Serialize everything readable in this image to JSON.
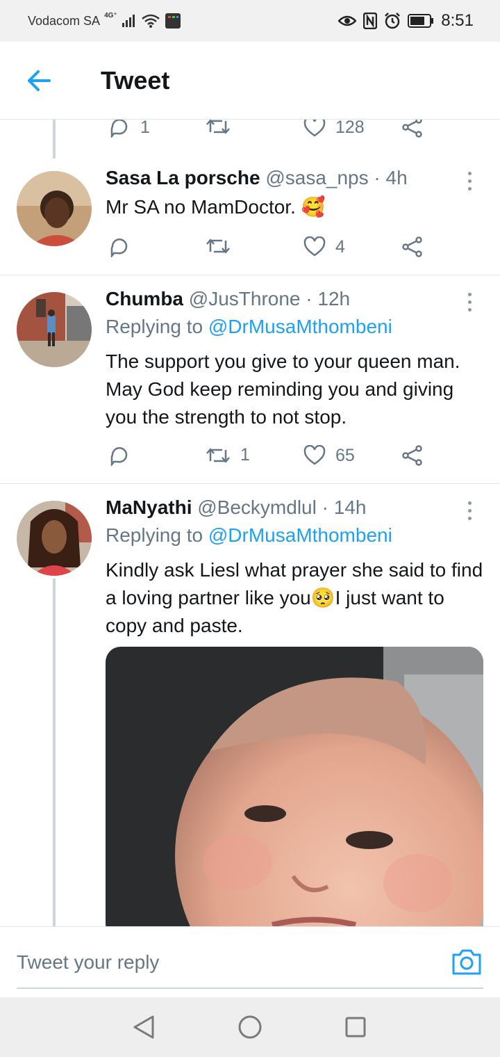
{
  "status_bar": {
    "carrier": "Vodacom SA",
    "network": "4G⁺",
    "time": "8:51"
  },
  "header": {
    "title": "Tweet"
  },
  "top_partial_actions": {
    "reply_count": "1",
    "retweet_count": "",
    "like_count": "128"
  },
  "tweets": [
    {
      "name": "Sasa La porsche",
      "handle": "@sasa_nps",
      "time": "· 4h",
      "replying_prefix": "",
      "replying_to": "",
      "text": "Mr SA no MamDoctor. 🥰",
      "reply_count": "",
      "retweet_count": "",
      "like_count": "4"
    },
    {
      "name": "Chumba",
      "handle": "@JusThrone",
      "time": "· 12h",
      "replying_prefix": "Replying to ",
      "replying_to": "@DrMusaMthombeni",
      "text": "The support you give to your queen man. May God keep reminding you and giving you the strength to not stop.",
      "reply_count": "",
      "retweet_count": "1",
      "like_count": "65"
    },
    {
      "name": "MaNyathi",
      "handle": "@Beckymdlul",
      "time": "· 14h",
      "replying_prefix": "Replying to ",
      "replying_to": "@DrMusaMthombeni",
      "text": "Kindly ask Liesl what prayer she said to find a loving partner like you🥺I just want to copy and paste."
    }
  ],
  "reply_bar": {
    "placeholder": "Tweet your reply"
  },
  "colors": {
    "accent": "#1da1f2",
    "secondary_text": "#657786",
    "divider": "#e1e8ed"
  },
  "icons": [
    "back-arrow-icon",
    "reply-icon",
    "retweet-icon",
    "like-icon",
    "share-icon",
    "more-icon",
    "camera-icon",
    "nav-back-icon",
    "nav-home-icon",
    "nav-recents-icon"
  ]
}
